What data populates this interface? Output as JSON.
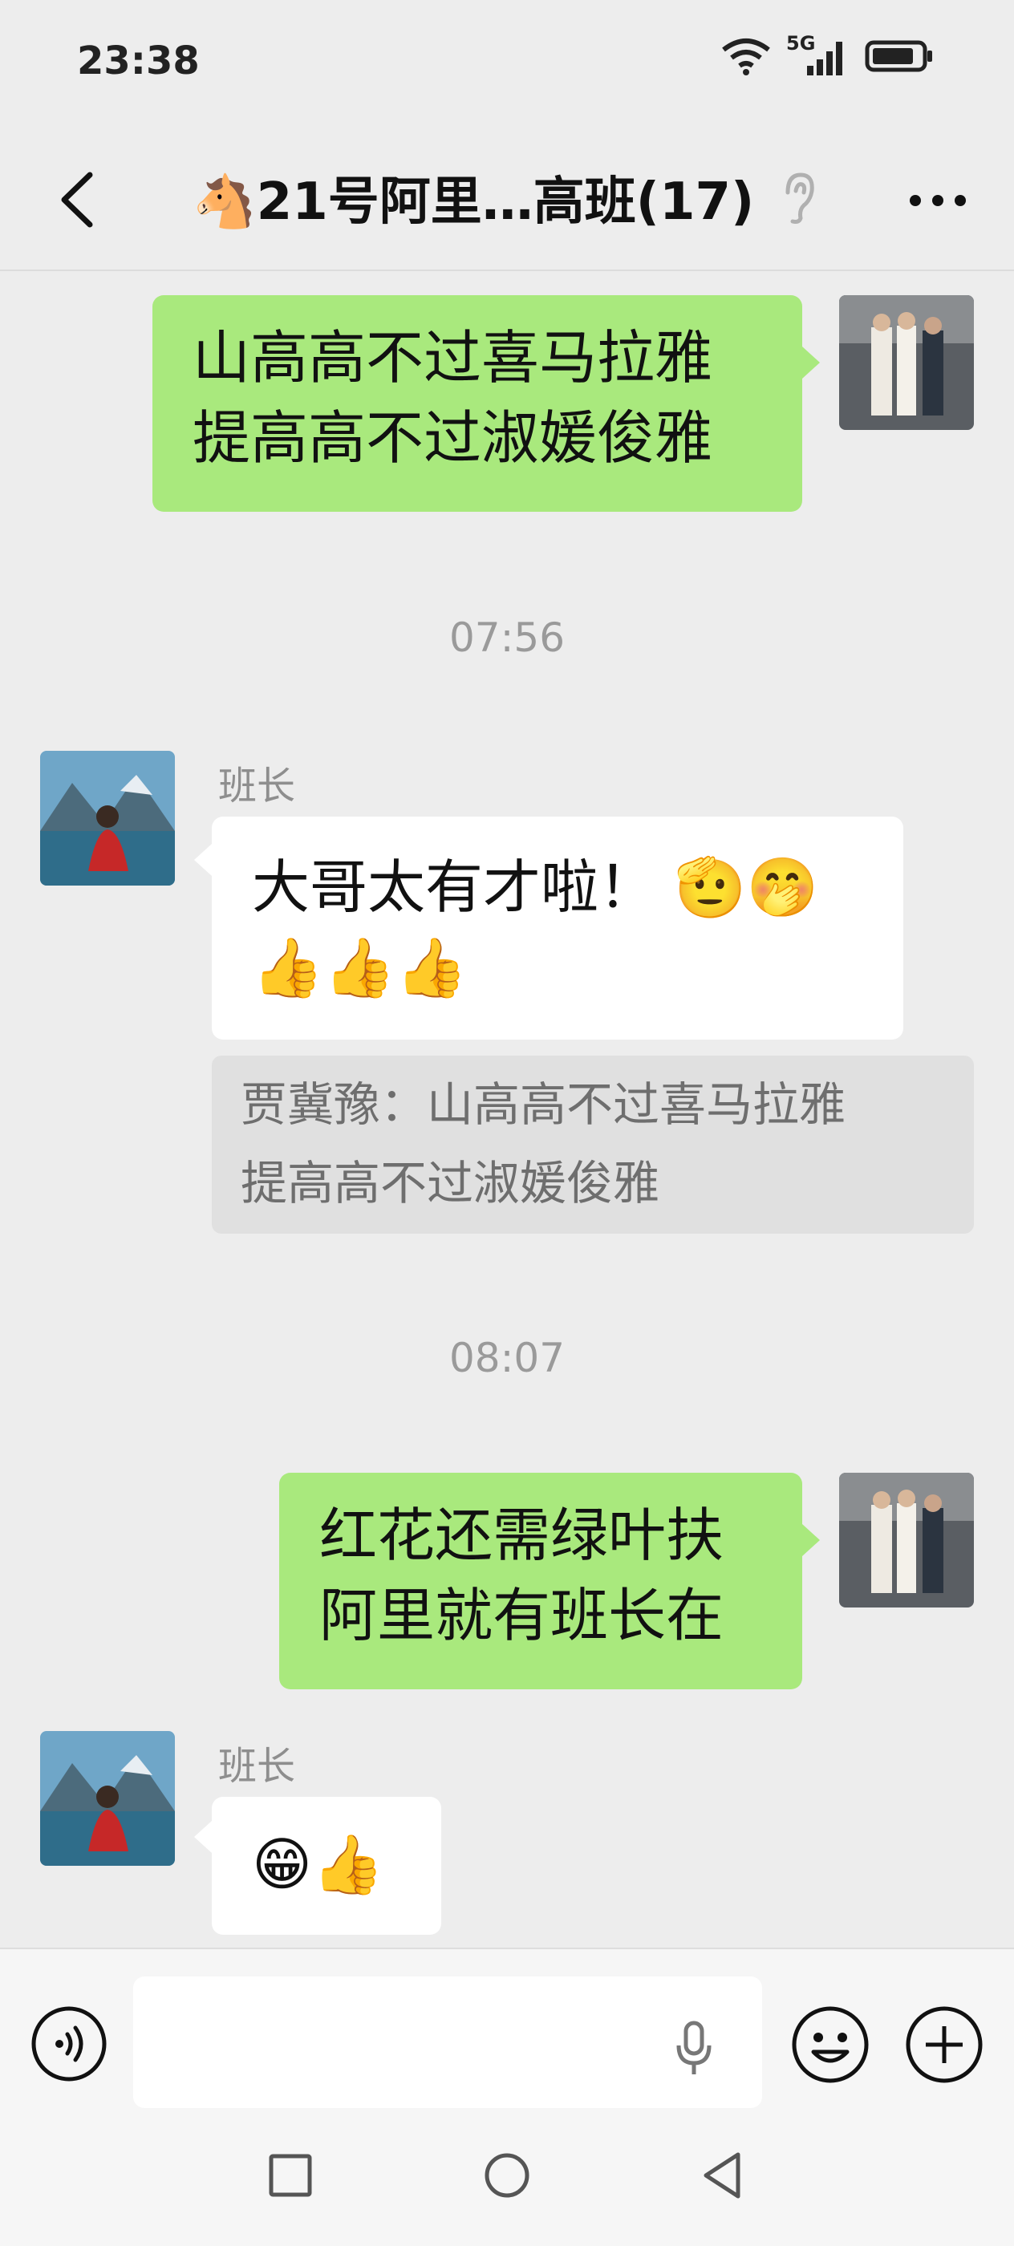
{
  "status_bar": {
    "time": "23:38",
    "network": "5G"
  },
  "header": {
    "title": "🐴21号阿里…高班(17)"
  },
  "messages": {
    "m1": {
      "line1": "山高高不过喜马拉雅",
      "line2": "提高高不过淑媛俊雅"
    },
    "time1": "07:56",
    "m2": {
      "sender": "班长",
      "line1": "大哥太有才啦！ 🫡🤭",
      "line2": "👍👍👍",
      "quote_line1": "贾冀豫：山高高不过喜马拉雅",
      "quote_line2": "提高高不过淑媛俊雅"
    },
    "time2": "08:07",
    "m3": {
      "line1": "红花还需绿叶扶",
      "line2": "阿里就有班长在"
    },
    "m4": {
      "sender": "班长",
      "text": "😁👍"
    }
  },
  "icons": {
    "back": "chevron-left-icon",
    "ear": "ear-icon",
    "more": "more-icon",
    "voice": "voice-icon",
    "mic": "microphone-icon",
    "emoji": "emoji-icon",
    "plus": "plus-icon"
  },
  "colors": {
    "sent_bubble": "#a9e97d",
    "received_bubble": "#ffffff",
    "background": "#ededed"
  }
}
